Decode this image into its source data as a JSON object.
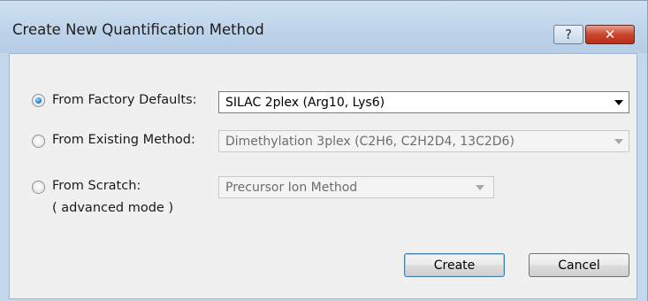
{
  "window": {
    "title": "Create New Quantification Method",
    "help_icon": "question-icon",
    "close_icon": "close-icon"
  },
  "options": [
    {
      "label": "From Factory Defaults:",
      "checked": true,
      "combo_value": "SILAC 2plex (Arg10, Lys6)",
      "enabled": true
    },
    {
      "label": "From Existing Method:",
      "checked": false,
      "combo_value": "Dimethylation 3plex (C2H6, C2H2D4, 13C2D6)",
      "enabled": false
    },
    {
      "label": "From Scratch:",
      "sublabel": "( advanced mode )",
      "checked": false,
      "combo_value": "Precursor Ion Method",
      "enabled": false
    }
  ],
  "buttons": {
    "create": "Create",
    "cancel": "Cancel"
  },
  "colors": {
    "titlebar": "#bdd3ea",
    "client": "#f0f0f0",
    "close_button": "#c9452c",
    "radio_selected": "#2a89d6"
  }
}
